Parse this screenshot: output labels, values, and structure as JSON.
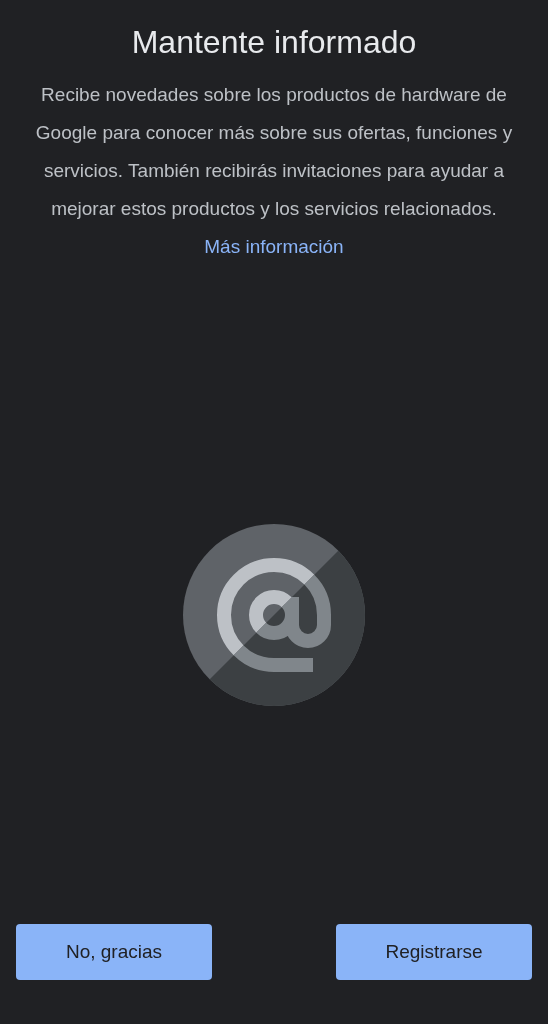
{
  "title": "Mantente informado",
  "description": "Recibe novedades sobre los productos de hardware de Google para conocer más sobre sus ofertas, funciones y servicios. También recibirás invitaciones para ayudar a mejorar estos productos y los servicios relacionados.",
  "link": "Más información",
  "buttons": [
    {
      "label": "No, gracias"
    },
    {
      "label": "Registrarse"
    }
  ]
}
